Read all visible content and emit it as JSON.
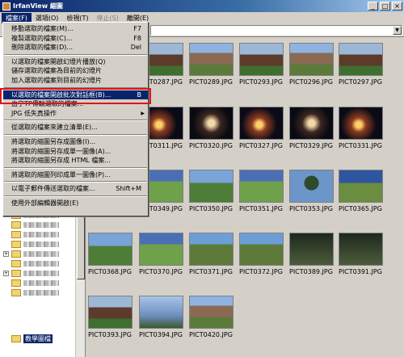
{
  "window": {
    "title": "IrfanView 縮圖"
  },
  "menubar": {
    "items": [
      {
        "label": "檔案(F)",
        "active": true
      },
      {
        "label": "選項(O)",
        "active": false
      },
      {
        "label": "檢視(T)",
        "active": false
      },
      {
        "label": "停止(S)",
        "active": false,
        "disabled": true
      },
      {
        "label": "離開(E)",
        "active": false
      }
    ]
  },
  "file_menu": {
    "items": [
      {
        "label": "移動選取的檔案(M)...",
        "shortcut": "F7"
      },
      {
        "label": "複製選取的檔案(C)...",
        "shortcut": "F8"
      },
      {
        "label": "刪除選取的檔案(D)...",
        "shortcut": "Del"
      },
      {
        "sep": true
      },
      {
        "label": "以選取的檔案開啟幻燈片播放(Q)",
        "shortcut": ""
      },
      {
        "label": "儲存選取的檔案為目前的幻燈片",
        "shortcut": ""
      },
      {
        "label": "加入選取的檔案到目前的幻燈片",
        "shortcut": ""
      },
      {
        "sep": true
      },
      {
        "label": "以選取的檔案開啟批次對話框(B)...",
        "shortcut": "B",
        "selected": true
      },
      {
        "label": "由宁TP傳輸選取的檔案...",
        "shortcut": ""
      },
      {
        "label": "JPG 低失真操作",
        "shortcut": "",
        "submenu": true
      },
      {
        "sep": true
      },
      {
        "label": "從選取的檔案來建立清單(E)...",
        "shortcut": ""
      },
      {
        "sep": true
      },
      {
        "label": "將選取的縮圖另存成圖像(I)...",
        "shortcut": ""
      },
      {
        "label": "將選取的縮圖另存成單一圖像(A)...",
        "shortcut": ""
      },
      {
        "label": "將選取的縮圖另存成 HTML 檔案...",
        "shortcut": ""
      },
      {
        "sep": true
      },
      {
        "label": "將選取的縮圖列印成單一圖像(P)...",
        "shortcut": ""
      },
      {
        "sep": true
      },
      {
        "label": "以電子郵件傳送選取的檔案...",
        "shortcut": "Shift+M"
      },
      {
        "sep": true
      },
      {
        "label": "使用外部編輯器開啟(E)",
        "shortcut": ""
      }
    ]
  },
  "tree": {
    "selected_folder": "教學圖檔"
  },
  "thumbnails": [
    {
      "name": "PICT0287.JPG",
      "style": "g-house",
      "label_visible": false
    },
    {
      "name": "PICT0289.JPG",
      "style": "g-build"
    },
    {
      "name": "PICT0293.JPG",
      "style": "g-house"
    },
    {
      "name": "PICT0296.JPG",
      "style": "g-build"
    },
    {
      "name": "PICT0297.JPG",
      "style": "g-house"
    },
    {
      "name": "PICT0311.JPG",
      "style": "g-night"
    },
    {
      "name": "PICT0320.JPG",
      "style": "g-night2"
    },
    {
      "name": "PICT0327.JPG",
      "style": "g-night"
    },
    {
      "name": "PICT0329.JPG",
      "style": "g-night2"
    },
    {
      "name": "PICT0331.JPG",
      "style": "g-night"
    },
    {
      "name": "PICT0349.JPG",
      "style": "g-grass"
    },
    {
      "name": "PICT0350.JPG",
      "style": "g-grass2"
    },
    {
      "name": "PICT0351.JPG",
      "style": "g-grass"
    },
    {
      "name": "PICT0353.JPG",
      "style": "g-tree"
    },
    {
      "name": "PICT0365.JPG",
      "style": "g-shed"
    },
    {
      "name": "PICT0368.JPG",
      "style": "g-grass2"
    },
    {
      "name": "PICT0370.JPG",
      "style": "g-grass"
    },
    {
      "name": "PICT0371.JPG",
      "style": "g-path"
    },
    {
      "name": "PICT0372.JPG",
      "style": "g-path"
    },
    {
      "name": "PICT0389.JPG",
      "style": "g-dark"
    },
    {
      "name": "PICT0391.JPG",
      "style": "g-dark"
    },
    {
      "name": "PICT0393.JPG",
      "style": "g-house"
    },
    {
      "name": "PICT0394.JPG",
      "style": "g-sky"
    },
    {
      "name": "PICT0420.JPG",
      "style": "g-build"
    }
  ],
  "accent_color": "#0a246a",
  "highlight_color": "#e0151b"
}
